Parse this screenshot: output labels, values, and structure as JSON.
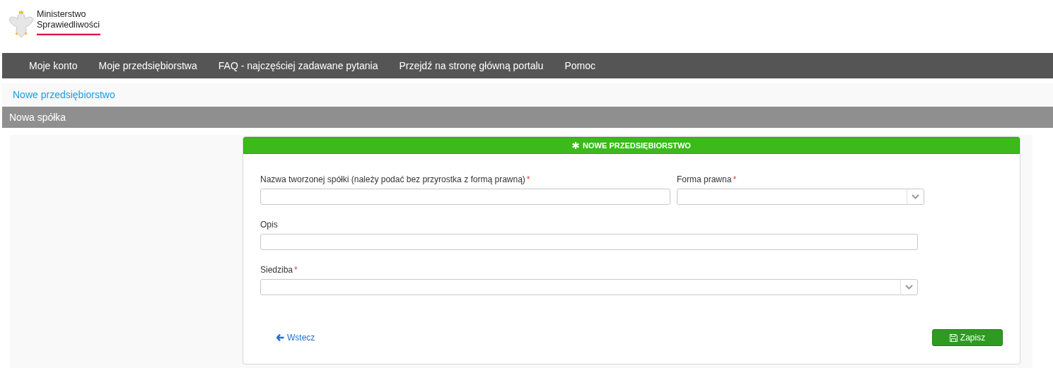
{
  "logo": {
    "line1": "Ministerstwo",
    "line2": "Sprawiedliwości"
  },
  "nav": [
    {
      "label": "Moje konto"
    },
    {
      "label": "Moje przedsiębiorstwa"
    },
    {
      "label": "FAQ - najczęściej zadawane pytania"
    },
    {
      "label": "Przejdź na stronę główną portalu"
    },
    {
      "label": "Pomoc"
    }
  ],
  "breadcrumb": "Nowe przedsiębiorstwo",
  "section_title": "Nowa spółka",
  "card": {
    "title": "NOWE PRZEDSIĘBIORSTWO",
    "rows": [
      [
        {
          "kind": "text",
          "label": "Nazwa tworzonej spółki (należy podać bez przyrostka z formą prawną)",
          "required_mark": "*"
        },
        {
          "kind": "select",
          "label": "Forma prawna",
          "required_mark": "*"
        }
      ],
      [
        {
          "kind": "text",
          "label": "Opis"
        }
      ],
      [
        {
          "kind": "select",
          "label": "Siedziba",
          "required_mark": "*"
        }
      ]
    ],
    "back_link": "Wstecz",
    "save_button": "Zapisz"
  }
}
